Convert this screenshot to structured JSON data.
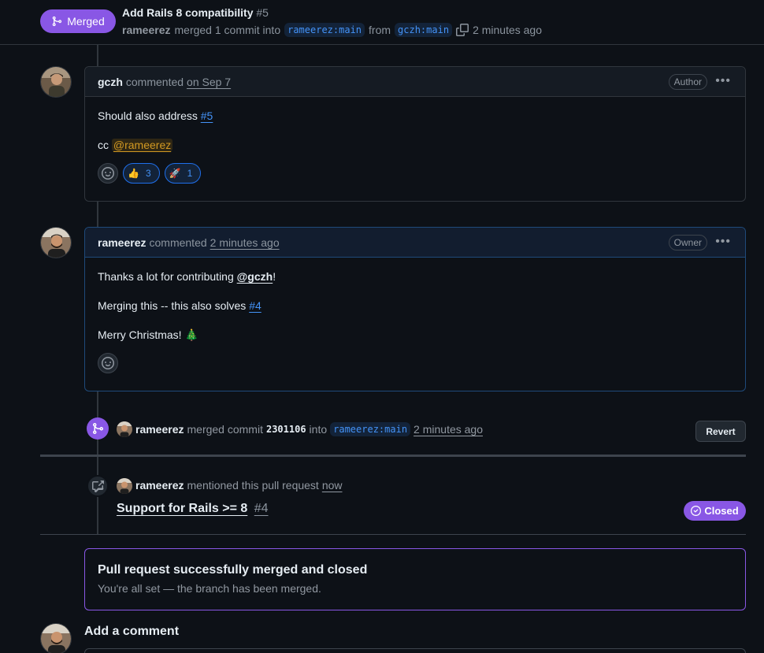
{
  "header": {
    "status": "Merged",
    "title": "Add Rails 8 compatibility",
    "number": "#5",
    "merger": "rameerez",
    "merged_text": "merged 1 commit into",
    "base_branch": "rameerez:main",
    "from_text": "from",
    "head_branch": "gczh:main",
    "time": "2 minutes ago"
  },
  "comment1": {
    "author": "gczh",
    "action": "commented",
    "time": "on Sep 7",
    "role": "Author",
    "line1_text": "Should also address",
    "line1_link": "#5",
    "line2_text": "cc",
    "line2_mention": "@rameerez",
    "reactions": [
      {
        "emoji": "👍",
        "count": "3"
      },
      {
        "emoji": "🚀",
        "count": "1"
      }
    ]
  },
  "comment2": {
    "author": "rameerez",
    "action": "commented",
    "time": "2 minutes ago",
    "role": "Owner",
    "line1_text": "Thanks a lot for contributing",
    "line1_mention": "@gczh",
    "line1_end": "!",
    "line2_text": "Merging this -- this also solves",
    "line2_link": "#4",
    "line3_text": "Merry Christmas! 🎄"
  },
  "merge_event": {
    "actor": "rameerez",
    "text": "merged commit",
    "sha": "2301106",
    "into": "into",
    "branch": "rameerez:main",
    "time": "2 minutes ago",
    "revert_label": "Revert"
  },
  "mention_event": {
    "actor": "rameerez",
    "text": "mentioned this pull request",
    "time": "now",
    "ref_title": "Support for Rails >= 8",
    "ref_number": "#4",
    "ref_status": "Closed"
  },
  "merged_box": {
    "heading": "Pull request successfully merged and closed",
    "subtext": "You're all set — the branch has been merged."
  },
  "add_comment": {
    "title": "Add a comment"
  },
  "colors": {
    "merged_purple": "#8957e5",
    "link_blue": "#4493f8",
    "background": "#0d1117"
  }
}
